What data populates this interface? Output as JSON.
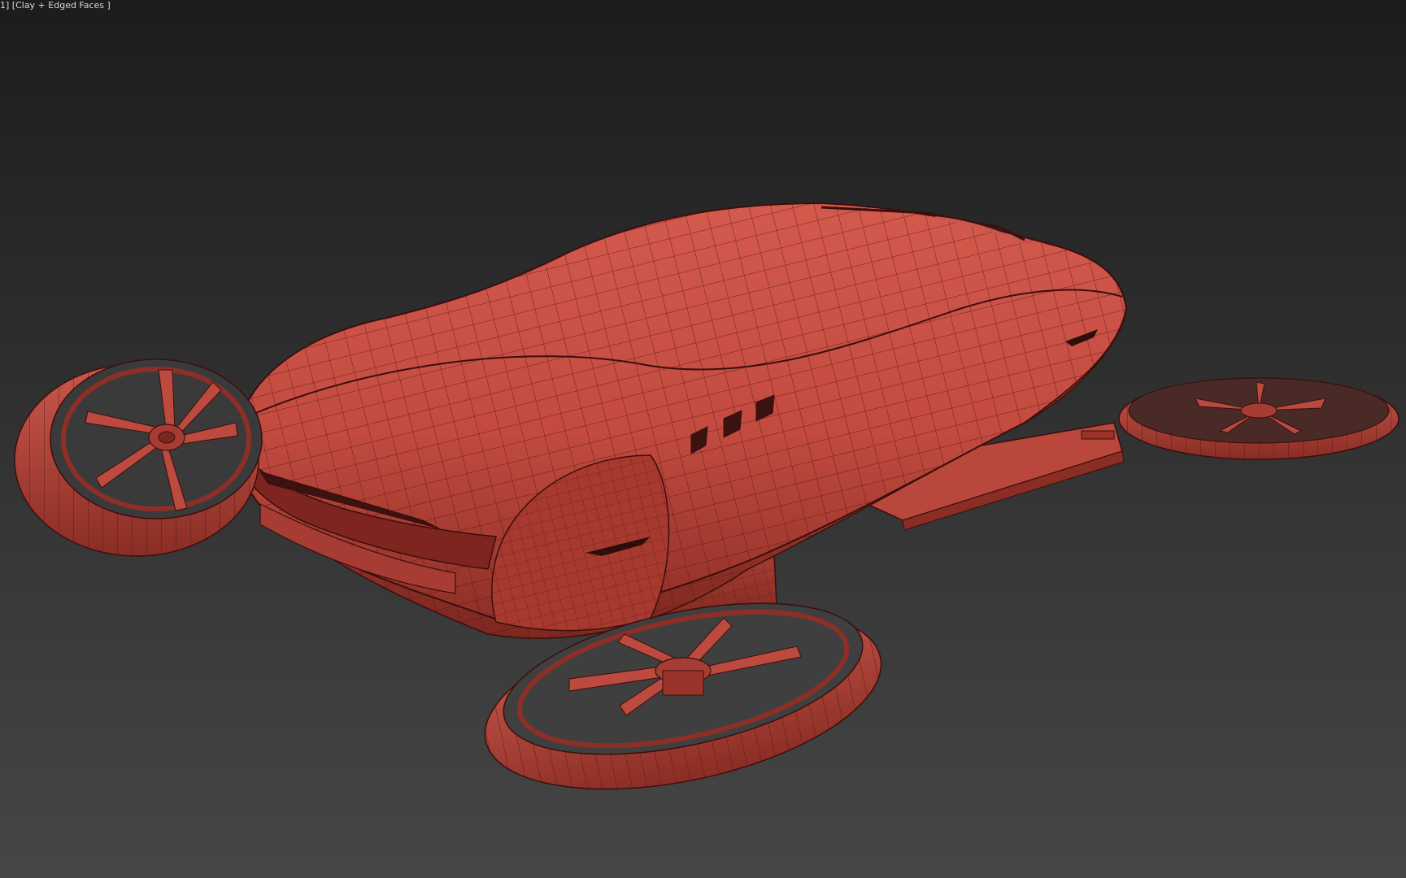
{
  "viewport": {
    "label": "1] [Clay + Edged Faces ]",
    "background_top": "#1c1c1c",
    "background_bottom": "#464646"
  },
  "model": {
    "subject": "flying-car-with-four-ducted-rotors",
    "material_color": "#c0463c",
    "edge_color": "#3a0f0c"
  }
}
